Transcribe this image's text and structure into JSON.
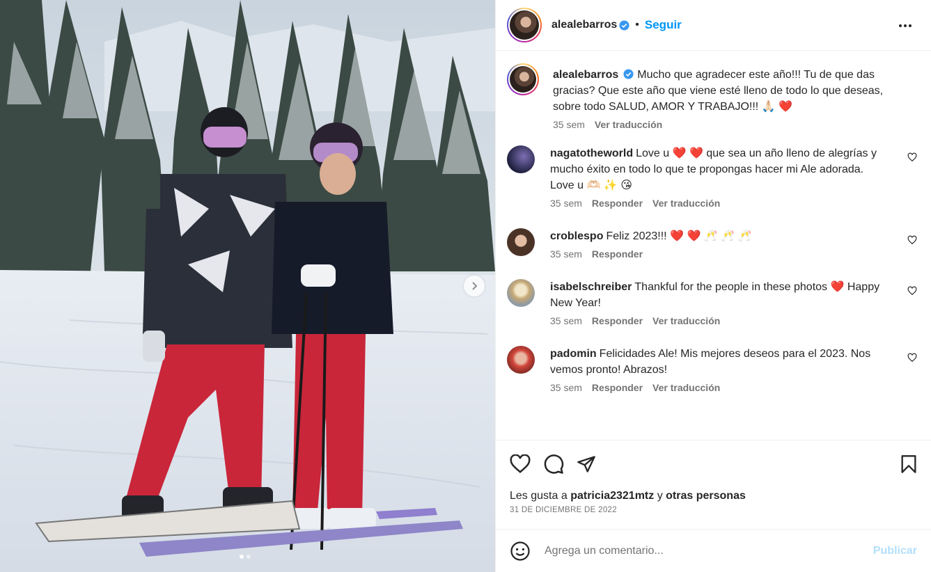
{
  "colors": {
    "accent": "#0095f6",
    "text": "#262626",
    "muted": "#737373",
    "heart": "#ed4956",
    "publish_disabled": "#b2dffc"
  },
  "media": {
    "alt": "Foto de alealebarros",
    "slides": 2,
    "active_slide": 1
  },
  "header": {
    "username": "alealebarros",
    "follow_label": "Seguir",
    "bullet": "•",
    "more_icon": "more-horizontal-icon"
  },
  "caption": {
    "username": "alealebarros",
    "text": "Mucho que agradecer este año!!! Tu de que das gracias? Que este año que viene esté lleno de todo lo que deseas, sobre todo SALUD, AMOR Y TRABAJO!!! 🙏🏻 ❤️",
    "time": "35 sem",
    "translate_label": "Ver traducción"
  },
  "comments": [
    {
      "username": "nagatotheworld",
      "text_line1": "Love u ❤️ ❤️  que sea un año lleno de alegrías y mucho éxito en todo lo que te propongas hacer mi Ale adorada.",
      "text_line2": "Love u 🫶🏻 ✨ 😘",
      "time": "35 sem",
      "reply_label": "Responder",
      "translate_label": "Ver traducción",
      "avatar_color": "#2c2d52"
    },
    {
      "username": "croblespo",
      "text_line1": "Feliz 2023!!! ❤️ ❤️ 🥂 🥂 🥂",
      "time": "35 sem",
      "reply_label": "Responder",
      "avatar_color": "#6b4a3a"
    },
    {
      "username": "isabelschreiber",
      "text_line1": "Thankful for the people in these photos ❤️ Happy New Year!",
      "time": "35 sem",
      "reply_label": "Responder",
      "translate_label": "Ver traducción",
      "avatar_color": "#c9b48a"
    },
    {
      "username": "padomin",
      "text_line1": "Felicidades Ale! Mis mejores deseos para el 2023. Nos vemos pronto! Abrazos!",
      "time": "35 sem",
      "reply_label": "Responder",
      "translate_label": "Ver traducción",
      "avatar_color": "#b83a32"
    }
  ],
  "likes": {
    "prefix": "Les gusta a",
    "user": "patricia2321mtz",
    "connector": "y",
    "others": "otras personas"
  },
  "date": "31 DE DICIEMBRE DE 2022",
  "composer": {
    "placeholder": "Agrega un comentario...",
    "publish_label": "Publicar"
  }
}
